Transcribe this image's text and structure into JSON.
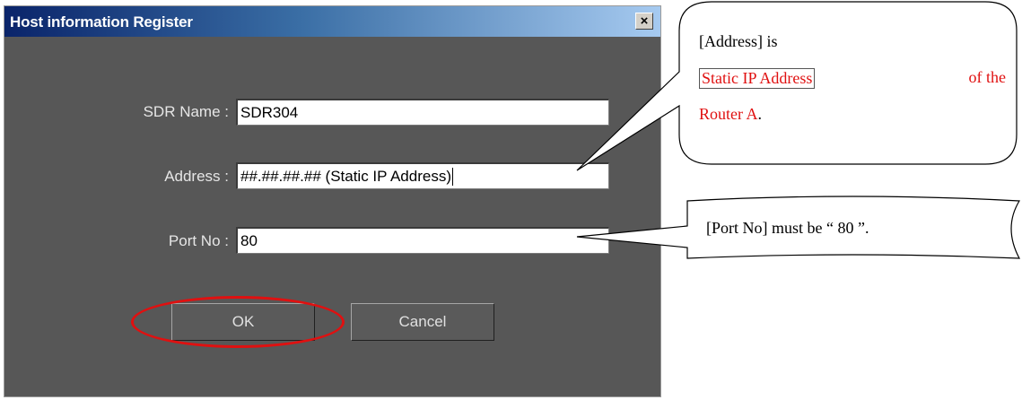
{
  "dialog": {
    "title": "Host information Register",
    "close_symbol": "×",
    "fields": {
      "sdr_name": {
        "label": "SDR Name :",
        "value": "SDR304"
      },
      "address": {
        "label": "Address :",
        "value": "##.##.##.## (Static IP Address)"
      },
      "port": {
        "label": "Port No :",
        "value": "80"
      }
    },
    "buttons": {
      "ok": "OK",
      "cancel": "Cancel"
    }
  },
  "callouts": {
    "address": {
      "line1": "[Address] is",
      "boxed": "Static IP Address",
      "line2_rest": "of the",
      "line3": "Router A",
      "line3_end": "."
    },
    "port": {
      "text": "[Port No] must be “ 80 ”."
    }
  },
  "colors": {
    "dialog_bg": "#575757",
    "titlebar_start": "#0a246a",
    "titlebar_end": "#a6caf0",
    "highlight_red": "#e01010"
  }
}
